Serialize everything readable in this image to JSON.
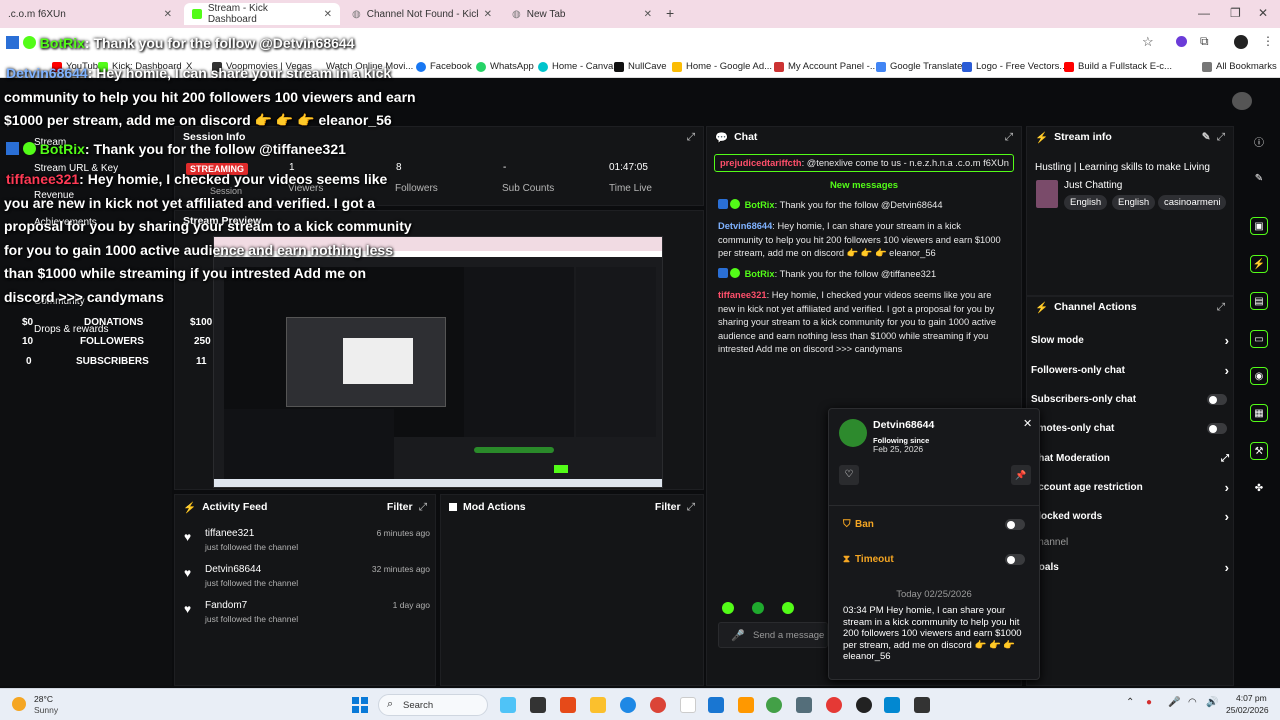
{
  "browser": {
    "tabs": [
      {
        "title": ".c.o.m f6XUn",
        "active": false
      },
      {
        "title": "Stream - Kick Dashboard",
        "active": true
      },
      {
        "title": "Channel Not Found - Kick Strea",
        "active": false
      },
      {
        "title": "New Tab",
        "active": false
      }
    ],
    "new_tab": "+",
    "bookmarks": [
      "YouTube",
      "Kick: Dashboard",
      "X",
      "Voopmovies | Vegas",
      "Watch Online Movi...",
      "Facebook",
      "WhatsApp",
      "Home - Canva",
      "NullCave",
      "Home - Google Ad...",
      "My Account Panel -...",
      "Google Translate",
      "Logo - Free Vectors...",
      "Build a Fullstack E-c...",
      "All Bookmarks"
    ]
  },
  "left_nav": {
    "items": [
      "Stream",
      "Session Info",
      "Stream URL & Key",
      "Revenue",
      "Achievements",
      "Stream Preview",
      "Community",
      "Drops & rewards"
    ]
  },
  "session_info": {
    "title": "Session Info",
    "status": "STREAMING",
    "stats": [
      {
        "value": "1",
        "label": "Viewers"
      },
      {
        "value": "8",
        "label": "Followers"
      },
      {
        "value": "-",
        "label": "Sub Counts"
      },
      {
        "value": "01:47:05",
        "label": "Time Live"
      }
    ],
    "session_label": "Session"
  },
  "goals": [
    {
      "current": "$0",
      "label": "DONATIONS",
      "target": "$100"
    },
    {
      "current": "10",
      "label": "FOLLOWERS",
      "target": "250"
    },
    {
      "current": "0",
      "label": "SUBSCRIBERS",
      "target": "11"
    }
  ],
  "stream_preview": {
    "title": "Stream Preview"
  },
  "activity_feed": {
    "title": "Activity Feed",
    "filter": "Filter",
    "items": [
      {
        "name": "tiffanee321",
        "action": "just followed the channel",
        "time": "6 minutes ago"
      },
      {
        "name": "Detvin68644",
        "action": "just followed the channel",
        "time": "32 minutes ago"
      },
      {
        "name": "Fandom7",
        "action": "just followed the channel",
        "time": "1 day ago"
      }
    ]
  },
  "mod_actions": {
    "title": "Mod Actions",
    "filter": "Filter"
  },
  "chat": {
    "title": "Chat",
    "pinned_user": "prejudicedtariffcth",
    "pinned_text": "@tenexlive come to us - n.e.z.h.n.a .c.o.m f6XUn",
    "new_messages": "New messages",
    "messages": [
      {
        "user": "BotRix",
        "color": "green",
        "text": "Thank you for the follow @Detvin68644"
      },
      {
        "user": "Detvin68644",
        "color": "blue",
        "text": "Hey homie, I can share your stream in a kick community to help you hit 200 followers 100 viewers and earn $1000 per stream, add me on discord 👉 👉 👉 eleanor_56"
      },
      {
        "user": "BotRix",
        "color": "green",
        "text": "Thank you for the follow @tiffanee321"
      },
      {
        "user": "tiffanee321",
        "color": "red",
        "text": "Hey homie, I checked your videos seems like you are new in kick not yet affiliated and verified. I got a proposal for you by sharing your stream to a kick community for you to gain 1000 active audience and earn nothing less than $1000 while streaming if you intrested Add me on discord >>> candymans"
      }
    ],
    "send_placeholder": "Send a message"
  },
  "stream_info": {
    "title": "Stream info",
    "stream_title": "Hustling | Learning skills to make Living",
    "category": "Just Chatting",
    "tags": [
      "English",
      "English",
      "casinoarmeni"
    ]
  },
  "channel_actions": {
    "title": "Channel Actions",
    "items": [
      "Slow mode",
      "Followers-only chat",
      "Subscribers-only chat",
      "Emotes-only chat",
      "Chat Moderation",
      "Account age restriction",
      "Blocked words",
      "Channel",
      "Goals"
    ]
  },
  "user_card": {
    "name": "Detvin68644",
    "following_label": "Following since",
    "following_date": "Feb 25, 2026",
    "ban_label": "Ban",
    "timeout_label": "Timeout",
    "date_divider": "Today 02/25/2026",
    "message_time": "03:34 PM",
    "message": "Hey homie, I can share your stream in a kick community to help you hit 200 followers 100 viewers and earn $1000 per stream, add me on discord 👉 👉 👉 eleanor_56"
  },
  "overlay": {
    "line1_user": "BotRix",
    "line1_text": ": Thank you for the follow @Detvin68644",
    "line2_user": "Detvin68644",
    "line2_text": ": Hey homie, I can share your stream in a kick",
    "line3": "community to help you hit 200 followers 100 viewers and earn",
    "line4": "$1000 per stream, add me on discord 👉 👉 👉 eleanor_56",
    "line5_user": "BotRix",
    "line5_text": ": Thank you for the follow @tiffanee321",
    "line6_user": "tiffanee321",
    "line6_text": ": Hey homie, I checked your videos seems like",
    "line7": "you are new in kick not yet affiliated and verified. I got a",
    "line8": "proposal for you by sharing your stream to a kick community",
    "line9": "for you to gain 1000 active audience and earn nothing less",
    "line10": "than $1000 while streaming if you intrested Add me on",
    "line11": "discord >>> candymans"
  },
  "taskbar": {
    "weather_temp": "28°C",
    "weather_desc": "Sunny",
    "search": "Search",
    "time": "4:07 pm",
    "date": "25/02/2026"
  }
}
